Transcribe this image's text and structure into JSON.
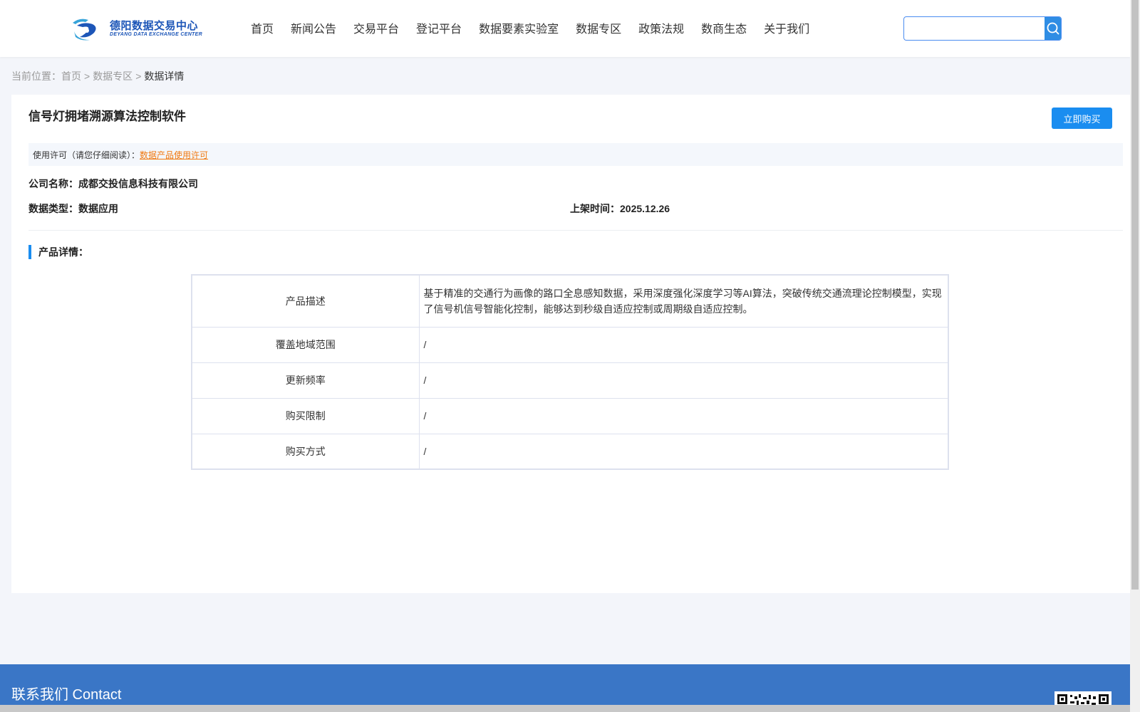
{
  "header": {
    "logo_cn": "德阳数据交易中心",
    "logo_en": "DEYANG DATA EXCHANGE CENTER",
    "nav": [
      "首页",
      "新闻公告",
      "交易平台",
      "登记平台",
      "数据要素实验室",
      "数据专区",
      "政策法规",
      "数商生态",
      "关于我们"
    ],
    "search_placeholder": "",
    "search_icon": "search-icon"
  },
  "breadcrumb": {
    "prefix": "当前位置：",
    "home": "首页",
    "sep1": ">",
    "section": "数据专区",
    "sep2": ">",
    "current": "数据详情"
  },
  "product": {
    "title": "信号灯拥堵溯源算法控制软件",
    "buy_label": "立即购买",
    "license_prefix": "使用许可（请您仔细阅读）：",
    "license_link": "数据产品使用许可",
    "company_label": "公司名称：",
    "company": "成都交投信息科技有限公司",
    "type_label": "数据类型：",
    "type": "数据应用",
    "listed_label": "上架时间：",
    "listed": "2025.12.26",
    "detail_heading": "产品详情："
  },
  "details": [
    {
      "label": "产品描述",
      "value": "基于精准的交通行为画像的路口全息感知数据，采用深度强化深度学习等AI算法，突破传统交通流理论控制模型，实现了信号机信号智能化控制，能够达到秒级自适应控制或周期级自适应控制。"
    },
    {
      "label": "覆盖地域范围",
      "value": "/"
    },
    {
      "label": "更新频率",
      "value": "/"
    },
    {
      "label": "购买限制",
      "value": "/"
    },
    {
      "label": "购买方式",
      "value": "/"
    }
  ],
  "footer": {
    "title": "联系我们 Contact"
  },
  "colors": {
    "accent": "#1a8df0",
    "link": "#f07a12",
    "footer": "#3a76c6"
  }
}
